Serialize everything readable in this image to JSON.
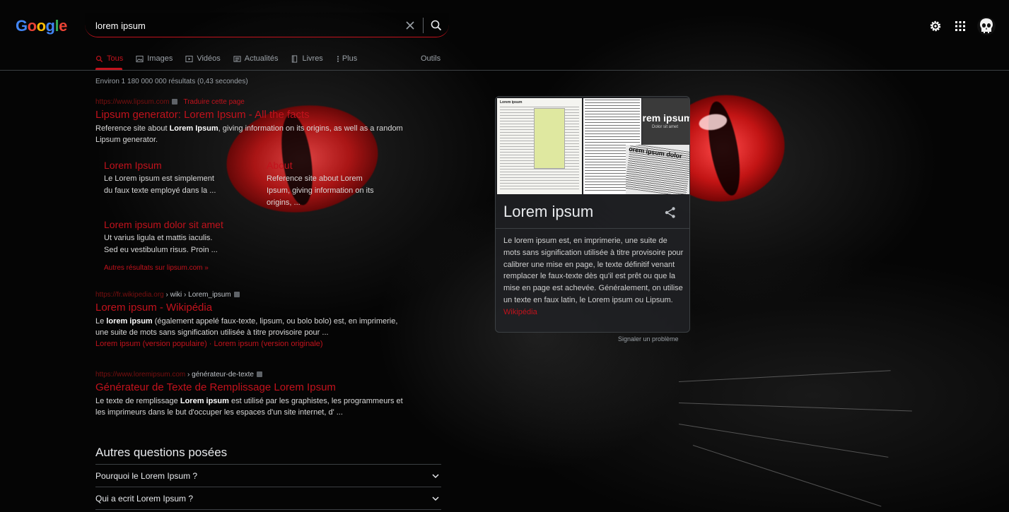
{
  "logo": {
    "text": "Google"
  },
  "search": {
    "query": "lorem ipsum",
    "placeholder": ""
  },
  "tabs": [
    {
      "label": "Tous",
      "icon": "search-icon",
      "active": true
    },
    {
      "label": "Images",
      "icon": "image-icon"
    },
    {
      "label": "Vidéos",
      "icon": "video-icon"
    },
    {
      "label": "Actualités",
      "icon": "news-icon"
    },
    {
      "label": "Livres",
      "icon": "book-icon"
    },
    {
      "label": "Plus",
      "icon": "more-vert-icon"
    }
  ],
  "tools_label": "Outils",
  "stats": "Environ 1 180 000 000 résultats (0,43 secondes)",
  "results": [
    {
      "cite": "https://www.lipsum.com",
      "path": "",
      "translate": "Traduire cette page",
      "title": "Lipsum generator: Lorem Ipsum - All the facts",
      "snippet_pre": "Reference site about ",
      "snippet_bold": "Lorem Ipsum",
      "snippet_post": ", giving information on its origins, as well as a random Lipsum generator."
    },
    {
      "cite": "https://fr.wikipedia.org",
      "path": " › wiki › Lorem_ipsum",
      "title": "Lorem ipsum - Wikipédia",
      "snippet_pre": "Le ",
      "snippet_bold": "lorem ipsum",
      "snippet_post": " (également appelé faux-texte, lipsum, ou bolo bolo) est, en imprimerie, une suite de mots sans signification utilisée à titre provisoire pour ...",
      "sublink1": "Lorem ipsum (version populaire)",
      "sublink_sep": " · ",
      "sublink2": "Lorem ipsum (version originale)"
    },
    {
      "cite": "https://www.loremipsum.com",
      "path": " › générateur-de-texte",
      "title": "Générateur de Texte de Remplissage Lorem Ipsum",
      "snippet_pre": "Le texte de remplissage ",
      "snippet_bold": "Lorem ipsum",
      "snippet_post": " est utilisé par les graphistes, les programmeurs et les imprimeurs dans le but d'occuper les espaces d'un site internet, d' ..."
    }
  ],
  "sitelinks": [
    {
      "title": "Lorem Ipsum",
      "text": "Le Lorem ipsum est simplement du faux texte employé dans la ..."
    },
    {
      "title": "About",
      "text": "Reference site about Lorem Ipsum, giving information on its origins, ..."
    },
    {
      "title": "Lorem ipsum dolor sit amet",
      "text": "Ut varius ligula et mattis iaculis. Sed eu vestibulum risus. Proin ..."
    }
  ],
  "more_results": "Autres résultats sur lipsum.com »",
  "paa": {
    "title": "Autres questions posées",
    "items": [
      "Pourquoi le Lorem Ipsum ?",
      "Qui a ecrit Lorem Ipsum ?"
    ]
  },
  "knowledge_panel": {
    "title": "Lorem ipsum",
    "description": "Le lorem ipsum est, en imprimerie, une suite de mots sans signification utilisée à titre provisoire pour calibrer une mise en page, le texte définitif venant remplacer le faux-texte dès qu'il est prêt ou que la mise en page est achevée. Généralement, on utilise un texte en faux latin, le Lorem ipsum ou Lipsum.",
    "source": "Wikipédia",
    "image_texts": {
      "img1_header": "Lorem ipsum",
      "img3_big": "orem ipsum",
      "img3_small": "Dolor sit amet",
      "img4_tag": "orem ipsum dolor"
    }
  },
  "report_problem": "Signaler un problème",
  "colors": {
    "accent": "#c2121c",
    "text": "#e8eaed",
    "muted": "#9aa0a6",
    "panel": "#202124"
  }
}
